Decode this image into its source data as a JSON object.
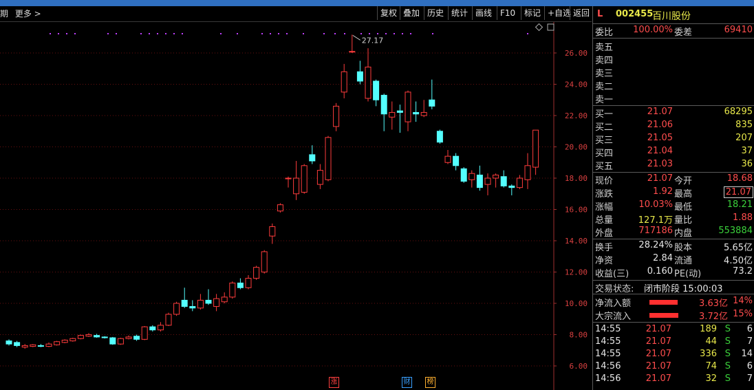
{
  "toolbar": {
    "left": [
      "期",
      "更多 >"
    ],
    "buttons": [
      "复权",
      "叠加",
      "历史",
      "统计",
      "画线",
      "F10",
      "标记",
      "+自选",
      "返回"
    ]
  },
  "chart_data": {
    "type": "candlestick",
    "ylim": [
      5.2,
      28.5
    ],
    "yticks": [
      "26.00",
      "24.00",
      "22.00",
      "20.00",
      "18.00",
      "16.00",
      "14.00",
      "12.00",
      "10.00",
      "8.00",
      "6.00"
    ],
    "high_marker": "27.17",
    "candles": [
      {
        "o": 7.6,
        "c": 7.4,
        "h": 7.7,
        "l": 7.3
      },
      {
        "o": 7.5,
        "c": 7.3,
        "h": 7.6,
        "l": 7.2
      },
      {
        "o": 7.2,
        "c": 7.3,
        "h": 7.4,
        "l": 7.1
      },
      {
        "o": 7.25,
        "c": 7.35,
        "h": 7.4,
        "l": 7.2
      },
      {
        "o": 7.3,
        "c": 7.25,
        "h": 7.4,
        "l": 7.2
      },
      {
        "o": 7.25,
        "c": 7.4,
        "h": 7.5,
        "l": 7.2
      },
      {
        "o": 7.35,
        "c": 7.55,
        "h": 7.6,
        "l": 7.3
      },
      {
        "o": 7.5,
        "c": 7.65,
        "h": 7.7,
        "l": 7.45
      },
      {
        "o": 7.6,
        "c": 7.75,
        "h": 7.8,
        "l": 7.55
      },
      {
        "o": 7.75,
        "c": 7.95,
        "h": 8.0,
        "l": 7.7
      },
      {
        "o": 7.9,
        "c": 8.0,
        "h": 8.1,
        "l": 7.85
      },
      {
        "o": 7.95,
        "c": 7.85,
        "h": 8.05,
        "l": 7.8
      },
      {
        "o": 7.85,
        "c": 7.8,
        "h": 7.9,
        "l": 7.75
      },
      {
        "o": 7.8,
        "c": 7.4,
        "h": 7.85,
        "l": 7.35
      },
      {
        "o": 7.4,
        "c": 7.75,
        "h": 7.8,
        "l": 7.35
      },
      {
        "o": 7.75,
        "c": 7.85,
        "h": 7.95,
        "l": 7.7
      },
      {
        "o": 7.9,
        "c": 7.7,
        "h": 8.0,
        "l": 7.6
      },
      {
        "o": 7.7,
        "c": 8.5,
        "h": 8.55,
        "l": 7.65
      },
      {
        "o": 8.5,
        "c": 8.3,
        "h": 8.6,
        "l": 8.2
      },
      {
        "o": 8.3,
        "c": 8.6,
        "h": 8.8,
        "l": 8.2
      },
      {
        "o": 8.6,
        "c": 9.3,
        "h": 9.4,
        "l": 8.55
      },
      {
        "o": 9.3,
        "c": 10.0,
        "h": 10.1,
        "l": 9.2
      },
      {
        "o": 10.2,
        "c": 9.8,
        "h": 11.0,
        "l": 9.7
      },
      {
        "o": 9.8,
        "c": 9.7,
        "h": 10.2,
        "l": 9.5
      },
      {
        "o": 9.7,
        "c": 10.2,
        "h": 10.6,
        "l": 9.6
      },
      {
        "o": 10.2,
        "c": 10.0,
        "h": 10.9,
        "l": 9.9
      },
      {
        "o": 9.8,
        "c": 10.3,
        "h": 10.6,
        "l": 9.5
      },
      {
        "o": 10.1,
        "c": 10.4,
        "h": 10.7,
        "l": 10.0
      },
      {
        "o": 10.4,
        "c": 11.3,
        "h": 11.4,
        "l": 10.3
      },
      {
        "o": 11.3,
        "c": 11.0,
        "h": 11.6,
        "l": 10.9
      },
      {
        "o": 11.0,
        "c": 11.6,
        "h": 11.8,
        "l": 10.9
      },
      {
        "o": 11.6,
        "c": 12.3,
        "h": 12.4,
        "l": 11.5
      },
      {
        "o": 12.0,
        "c": 13.3,
        "h": 13.4,
        "l": 11.9
      },
      {
        "o": 14.3,
        "c": 14.9,
        "h": 15.1,
        "l": 13.8
      },
      {
        "o": 15.9,
        "c": 16.3,
        "h": 16.4,
        "l": 15.8
      },
      {
        "o": 18.0,
        "c": 18.0,
        "h": 18.1,
        "l": 17.4
      },
      {
        "o": 17.0,
        "c": 18.0,
        "h": 19.1,
        "l": 16.6
      },
      {
        "o": 17.1,
        "c": 18.8,
        "h": 18.9,
        "l": 17.0
      },
      {
        "o": 19.5,
        "c": 19.1,
        "h": 20.1,
        "l": 18.9
      },
      {
        "o": 17.6,
        "c": 18.5,
        "h": 18.9,
        "l": 17.3
      },
      {
        "o": 17.9,
        "c": 20.6,
        "h": 20.7,
        "l": 17.8
      },
      {
        "o": 21.3,
        "c": 22.6,
        "h": 22.8,
        "l": 21.0
      },
      {
        "o": 23.5,
        "c": 24.8,
        "h": 25.3,
        "l": 23.1
      },
      {
        "o": 26.1,
        "c": 26.1,
        "h": 27.17,
        "l": 26.0
      },
      {
        "o": 24.8,
        "c": 24.2,
        "h": 25.5,
        "l": 24.0
      },
      {
        "o": 23.1,
        "c": 25.1,
        "h": 26.3,
        "l": 22.9
      },
      {
        "o": 24.2,
        "c": 23.0,
        "h": 24.3,
        "l": 22.6
      },
      {
        "o": 23.3,
        "c": 22.1,
        "h": 23.4,
        "l": 21.0
      },
      {
        "o": 21.9,
        "c": 22.2,
        "h": 22.9,
        "l": 21.1
      },
      {
        "o": 22.3,
        "c": 22.2,
        "h": 22.7,
        "l": 20.9
      },
      {
        "o": 21.6,
        "c": 23.5,
        "h": 23.6,
        "l": 21.0
      },
      {
        "o": 22.2,
        "c": 22.1,
        "h": 22.9,
        "l": 21.6
      },
      {
        "o": 22.0,
        "c": 22.2,
        "h": 23.0,
        "l": 21.9
      },
      {
        "o": 23.0,
        "c": 22.6,
        "h": 24.3,
        "l": 22.4
      },
      {
        "o": 21.0,
        "c": 20.3,
        "h": 21.1,
        "l": 20.2
      },
      {
        "o": 19.0,
        "c": 19.4,
        "h": 19.8,
        "l": 18.9
      },
      {
        "o": 19.4,
        "c": 18.8,
        "h": 19.6,
        "l": 18.5
      },
      {
        "o": 18.6,
        "c": 17.8,
        "h": 18.7,
        "l": 17.7
      },
      {
        "o": 17.9,
        "c": 18.3,
        "h": 18.5,
        "l": 17.4
      },
      {
        "o": 18.2,
        "c": 17.4,
        "h": 18.8,
        "l": 17.2
      },
      {
        "o": 17.6,
        "c": 18.0,
        "h": 18.3,
        "l": 16.9
      },
      {
        "o": 18.0,
        "c": 18.2,
        "h": 18.3,
        "l": 17.4
      },
      {
        "o": 18.1,
        "c": 17.5,
        "h": 18.5,
        "l": 17.4
      },
      {
        "o": 17.5,
        "c": 17.4,
        "h": 17.6,
        "l": 16.9
      },
      {
        "o": 17.4,
        "c": 18.0,
        "h": 18.2,
        "l": 17.3
      },
      {
        "o": 17.9,
        "c": 18.8,
        "h": 19.6,
        "l": 17.3
      },
      {
        "o": 18.7,
        "c": 21.07,
        "h": 21.07,
        "l": 18.21
      }
    ],
    "bottom_badges": [
      {
        "text": "涨",
        "color": "#ff4040"
      },
      {
        "text": "财",
        "color": "#3aa0ff"
      },
      {
        "text": "榜",
        "color": "#ffb030"
      }
    ]
  },
  "quote": {
    "market": "L",
    "code": "002455",
    "name": "百川股份",
    "weibi_label": "委比",
    "weibi": "100.00%",
    "weicha_label": "委差",
    "weicha": "69410",
    "sell": [
      {
        "label": "卖五",
        "price": "",
        "vol": ""
      },
      {
        "label": "卖四",
        "price": "",
        "vol": ""
      },
      {
        "label": "卖三",
        "price": "",
        "vol": ""
      },
      {
        "label": "卖二",
        "price": "",
        "vol": ""
      },
      {
        "label": "卖一",
        "price": "",
        "vol": ""
      }
    ],
    "buy": [
      {
        "label": "买一",
        "price": "21.07",
        "vol": "68295"
      },
      {
        "label": "买二",
        "price": "21.06",
        "vol": "835"
      },
      {
        "label": "买三",
        "price": "21.05",
        "vol": "207"
      },
      {
        "label": "买四",
        "price": "21.04",
        "vol": "37"
      },
      {
        "label": "买五",
        "price": "21.03",
        "vol": "36"
      }
    ],
    "stats1": [
      {
        "l1": "现价",
        "v1": "21.07",
        "l2": "今开",
        "v2": "18.68"
      },
      {
        "l1": "涨跌",
        "v1": "1.92",
        "l2": "最高",
        "v2": "21.07"
      },
      {
        "l1": "涨幅",
        "v1": "10.03%",
        "l2": "最低",
        "v2": "18.21"
      },
      {
        "l1": "总量",
        "v1": "127.1万",
        "l2": "量比",
        "v2": "1.88"
      },
      {
        "l1": "外盘",
        "v1": "717186",
        "l2": "内盘",
        "v2": "553884"
      }
    ],
    "stats2": [
      {
        "l1": "换手",
        "v1": "28.24%",
        "l2": "股本",
        "v2": "5.65亿"
      },
      {
        "l1": "净资",
        "v1": "2.84",
        "l2": "流通",
        "v2": "4.50亿"
      },
      {
        "l1": "收益(三)",
        "v1": "0.160",
        "l2": "PE(动)",
        "v2": "73.2"
      }
    ],
    "trade_status_label": "交易状态:",
    "trade_status": "闭市阶段 15:00:03",
    "flows": [
      {
        "label": "净流入额",
        "amount": "3.63亿",
        "pct": "14%",
        "fill": 0.6
      },
      {
        "label": "大宗流入",
        "amount": "3.72亿",
        "pct": "15%",
        "fill": 0.62
      }
    ],
    "ticks": [
      {
        "time": "14:55",
        "price": "21.07",
        "vol": "189",
        "side": "S",
        "n": "6"
      },
      {
        "time": "14:55",
        "price": "21.07",
        "vol": "44",
        "side": "S",
        "n": "7"
      },
      {
        "time": "14:55",
        "price": "21.07",
        "vol": "336",
        "side": "S",
        "n": "14"
      },
      {
        "time": "14:56",
        "price": "21.07",
        "vol": "74",
        "side": "S",
        "n": "6"
      },
      {
        "time": "14:56",
        "price": "21.07",
        "vol": "32",
        "side": "S",
        "n": "7"
      }
    ]
  }
}
